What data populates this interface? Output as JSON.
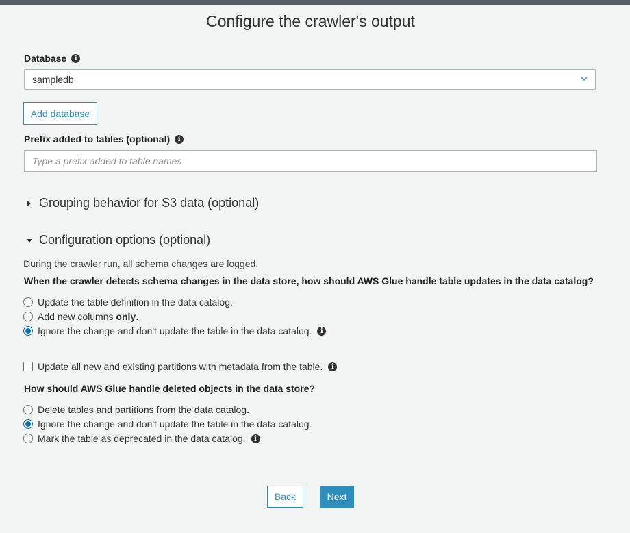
{
  "page": {
    "title": "Configure the crawler's output"
  },
  "database": {
    "label": "Database",
    "info_icon": "info-icon",
    "selected": "sampledb",
    "add_button": "Add database"
  },
  "prefix": {
    "label": "Prefix added to tables (optional)",
    "info_icon": "info-icon",
    "value": "",
    "placeholder": "Type a prefix added to table names"
  },
  "grouping": {
    "label": "Grouping behavior for S3 data (optional)",
    "expanded": false,
    "icon": "caret-right-icon"
  },
  "config": {
    "label": "Configuration options (optional)",
    "expanded": true,
    "icon": "caret-down-icon",
    "description": "During the crawler run, all schema changes are logged.",
    "schema_question": "When the crawler detects schema changes in the data store, how should AWS Glue handle table updates in the data catalog?",
    "schema_options": [
      {
        "label": "Update the table definition in the data catalog.",
        "checked": false
      },
      {
        "label_before": "Add new columns ",
        "label_bold": "only",
        "label_after": ".",
        "checked": false
      },
      {
        "label": "Ignore the change and don't update the table in the data catalog.",
        "checked": true,
        "info_icon": "info-icon"
      }
    ],
    "partitions_checkbox": {
      "label": "Update all new and existing partitions with metadata from the table.",
      "checked": false,
      "info_icon": "info-icon"
    },
    "deleted_question": "How should AWS Glue handle deleted objects in the data store?",
    "deleted_options": [
      {
        "label": "Delete tables and partitions from the data catalog.",
        "checked": false
      },
      {
        "label": "Ignore the change and don't update the table in the data catalog.",
        "checked": true
      },
      {
        "label": "Mark the table as deprecated in the data catalog.",
        "checked": false,
        "info_icon": "info-icon"
      }
    ]
  },
  "footer": {
    "back_label": "Back",
    "next_label": "Next"
  },
  "colors": {
    "accent": "#2e8ebd",
    "radio_checked": "#0073bb",
    "background": "#f2f3f3",
    "topbar": "#545b64"
  }
}
